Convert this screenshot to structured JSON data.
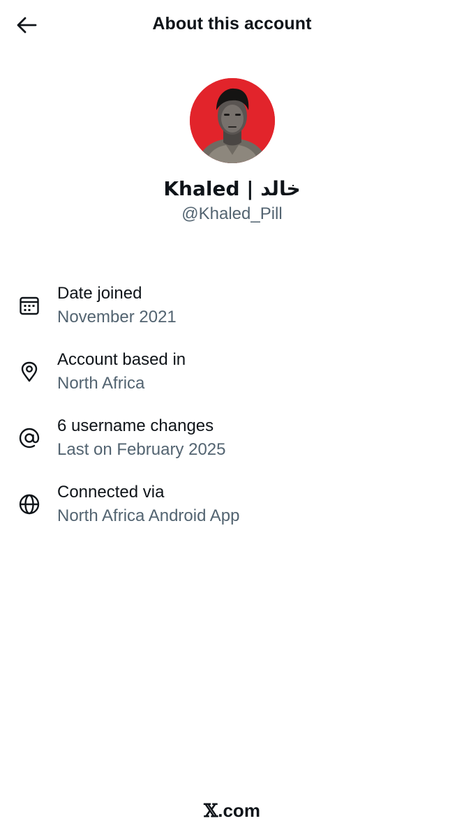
{
  "header": {
    "title": "About this account",
    "back_icon": "arrow-left-icon"
  },
  "profile": {
    "display_name": "Khaled | خالد",
    "handle": "@Khaled_Pill",
    "avatar_bg": "#e2242b"
  },
  "info": [
    {
      "icon": "calendar-icon",
      "title": "Date joined",
      "sub": "November 2021"
    },
    {
      "icon": "location-pin-icon",
      "title": "Account based in",
      "sub": "North Africa"
    },
    {
      "icon": "at-sign-icon",
      "title": "6 username changes",
      "sub": "Last on February 2025"
    },
    {
      "icon": "globe-icon",
      "title": "Connected via",
      "sub": "North Africa Android App"
    }
  ],
  "footer": {
    "x_mark": "𝕏",
    "domain": ".com"
  },
  "colors": {
    "primary_text": "#0f1419",
    "secondary_text": "#536471",
    "background": "#ffffff"
  }
}
